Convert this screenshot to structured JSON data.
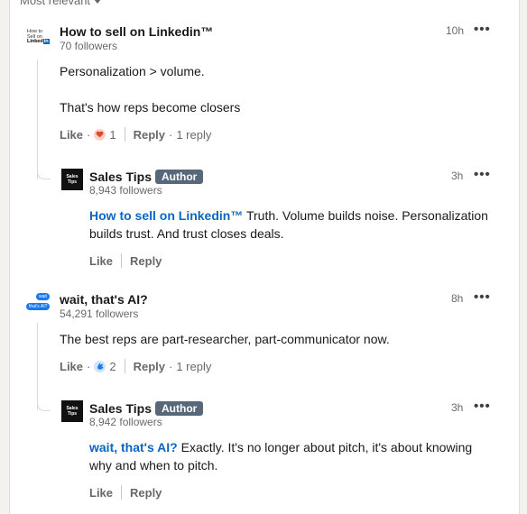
{
  "sort_label": "Most relevant",
  "comments": [
    {
      "author": "How to sell on Linkedin™",
      "followers": "70 followers",
      "time": "10h",
      "avatar_text": "How to Sell on",
      "avatar_brand": "Linked",
      "avatar_in": "in",
      "lines": [
        "Personalization > volume.",
        "That's how reps become closers"
      ],
      "like_label": "Like",
      "reaction_icon": "heart-reaction-icon",
      "reaction_count": "1",
      "reply_label": "Reply",
      "replies_count": "1 reply",
      "reply": {
        "author": "Sales Tips",
        "badge": "Author",
        "followers": "8,943 followers",
        "time": "3h",
        "avatar_text": "Sales Tips",
        "mention": "How to sell on Linkedin™",
        "text": " Truth. Volume builds noise. Personalization builds trust. And trust closes deals.",
        "like_label": "Like",
        "reply_label": "Reply"
      }
    },
    {
      "author": "wait, that's AI?",
      "followers": "54,291 followers",
      "time": "8h",
      "avatar_bubble_1": "wait",
      "avatar_bubble_2": "that's AI?",
      "lines": [
        "The best reps are part-researcher, part-communicator now."
      ],
      "like_label": "Like",
      "reaction_icon": "clap-reaction-icon",
      "reaction_count": "2",
      "reply_label": "Reply",
      "replies_count": "1 reply",
      "reply": {
        "author": "Sales Tips",
        "badge": "Author",
        "followers": "8,942 followers",
        "time": "3h",
        "avatar_text": "Sales Tips",
        "mention": "wait, that's AI?",
        "text": " Exactly. It's no longer about pitch, it's about knowing why and when to pitch.",
        "like_label": "Like",
        "reply_label": "Reply"
      }
    }
  ],
  "colors": {
    "link": "#0a66c2",
    "author_badge": "#56687a",
    "heart": "#e0472c",
    "clap": "#1877f2"
  }
}
